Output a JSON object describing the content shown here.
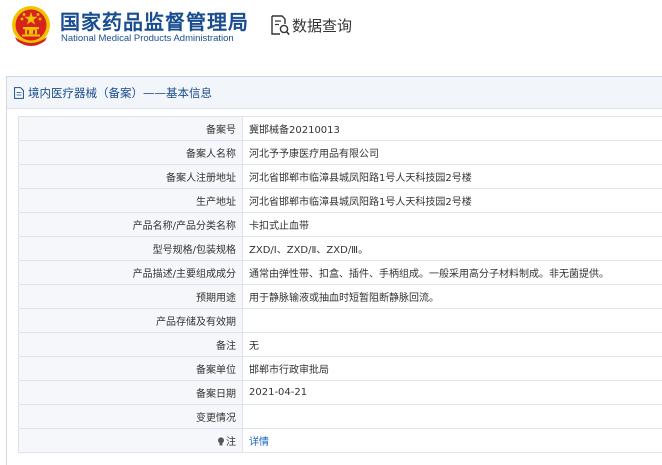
{
  "header": {
    "org_cn": "国家药品监督管理局",
    "org_en": "National Medical Products Administration",
    "query_label": "数据查询"
  },
  "panel": {
    "title": "境内医疗器械（备案）——基本信息"
  },
  "rows": [
    {
      "label": "备案号",
      "value": "冀邯械备20210013"
    },
    {
      "label": "备案人名称",
      "value": "河北予予康医疗用品有限公司"
    },
    {
      "label": "备案人注册地址",
      "value": "河北省邯郸市临漳县城凤阳路1号人天科技园2号楼"
    },
    {
      "label": "生产地址",
      "value": "河北省邯郸市临漳县城凤阳路1号人天科技园2号楼"
    },
    {
      "label": "产品名称/产品分类名称",
      "value": "卡扣式止血带"
    },
    {
      "label": "型号规格/包装规格",
      "value": "ZXD/Ⅰ、ZXD/Ⅱ、ZXD/Ⅲ。"
    },
    {
      "label": "产品描述/主要组成成分",
      "value": "通常由弹性带、扣盒、插件、手柄组成。一般采用高分子材料制成。非无菌提供。"
    },
    {
      "label": "预期用途",
      "value": "用于静脉输液或抽血时短暂阻断静脉回流。"
    },
    {
      "label": "产品存储及有效期",
      "value": ""
    },
    {
      "label": "备注",
      "value": "无"
    },
    {
      "label": "备案单位",
      "value": "邯郸市行政审批局"
    },
    {
      "label": "备案日期",
      "value": "2021-04-21"
    },
    {
      "label": "变更情况",
      "value": ""
    }
  ],
  "note_row": {
    "label": "注",
    "link": "详情"
  },
  "colors": {
    "brand_blue": "#1a4d8f",
    "emblem_red": "#d8231c",
    "emblem_gold": "#f2c400",
    "link_blue": "#1a62c4"
  }
}
